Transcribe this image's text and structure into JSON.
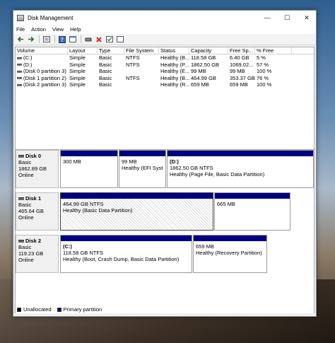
{
  "window": {
    "title": "Disk Management",
    "controls": {
      "minimize": "—",
      "maximize": "☐",
      "close": "✕"
    }
  },
  "menu": [
    "File",
    "Action",
    "View",
    "Help"
  ],
  "toolbar": {
    "icons": [
      "back-arrow-icon",
      "forward-arrow-icon",
      "disk-list-icon",
      "help-icon",
      "properties-icon",
      "connect-icon",
      "delete-icon",
      "check-icon",
      "refresh-icon"
    ]
  },
  "volume_table": {
    "headers": [
      "Volume",
      "Layout",
      "Type",
      "File System",
      "Status",
      "Capacity",
      "Free Sp...",
      "% Free"
    ],
    "rows": [
      [
        "(C:)",
        "Simple",
        "Basic",
        "NTFS",
        "Healthy (B...",
        "118.58 GB",
        "6.40 GB",
        "5 %"
      ],
      [
        "(D:)",
        "Simple",
        "Basic",
        "NTFS",
        "Healthy (P...",
        "1862.50 GB",
        "1069.02...",
        "57 %"
      ],
      [
        "(Disk 0 partition 3)",
        "Simple",
        "Basic",
        "",
        "Healthy (E...",
        "99 MB",
        "99 MB",
        "100 %"
      ],
      [
        "(Disk 1 partition 2)",
        "Simple",
        "Basic",
        "NTFS",
        "Healthy (B...",
        "464.99 GB",
        "353.37 GB",
        "76 %"
      ],
      [
        "(Disk 2 partition 3)",
        "Simple",
        "Basic",
        "",
        "Healthy (R...",
        "659 MB",
        "659 MB",
        "100 %"
      ]
    ]
  },
  "disks": [
    {
      "name": "Disk 0",
      "type": "Basic",
      "size": "1862.89 GB",
      "state": "Online",
      "partitions": [
        {
          "title": "",
          "line1": "300 MB",
          "line2": ""
        },
        {
          "title": "",
          "line1": "99 MB",
          "line2": "Healthy (EFI System"
        },
        {
          "title": "(D:)",
          "line1": "1862.50 GB NTFS",
          "line2": "Healthy (Page File, Basic Data Partition)"
        }
      ]
    },
    {
      "name": "Disk 1",
      "type": "Basic",
      "size": "465.64 GB",
      "state": "Online",
      "partitions": [
        {
          "title": "",
          "line1": "464.99 GB NTFS",
          "line2": "Healthy (Basic Data Partition)"
        },
        {
          "title": "",
          "line1": "665 MB",
          "line2": ""
        }
      ]
    },
    {
      "name": "Disk 2",
      "type": "Basic",
      "size": "119.23 GB",
      "state": "Online",
      "partitions": [
        {
          "title": "(C:)",
          "line1": "118.58 GB NTFS",
          "line2": "Healthy (Boot, Crash Dump, Basic Data Partition)"
        },
        {
          "title": "",
          "line1": "659 MB",
          "line2": "Healthy (Recovery Partition)"
        }
      ]
    }
  ],
  "legend": {
    "unallocated": "Unallocated",
    "primary": "Primary partition"
  },
  "colors": {
    "primary_partition": "#000080",
    "unallocated": "#000000"
  }
}
